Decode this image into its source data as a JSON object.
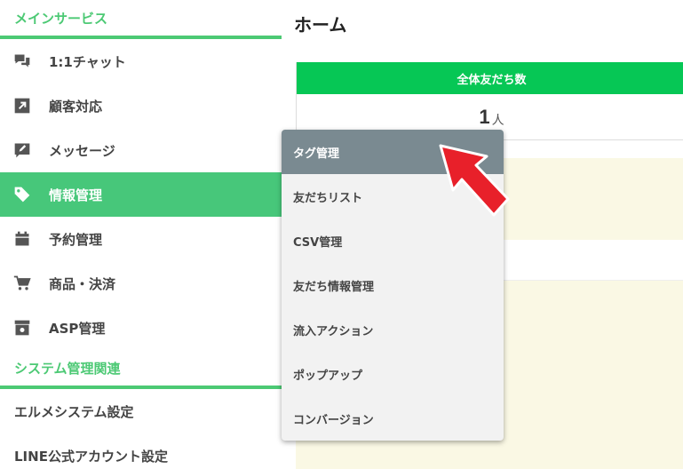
{
  "sidebar": {
    "main_section_title": "メインサービス",
    "items": [
      {
        "label": "1:1チャット",
        "icon": "chat-bubbles-icon"
      },
      {
        "label": "顧客対応",
        "icon": "arrow-up-right-icon"
      },
      {
        "label": "メッセージ",
        "icon": "edit-message-icon"
      },
      {
        "label": "情報管理",
        "icon": "tag-icon",
        "active": true
      },
      {
        "label": "予約管理",
        "icon": "calendar-icon"
      },
      {
        "label": "商品・決済",
        "icon": "cart-icon"
      },
      {
        "label": "ASP管理",
        "icon": "archive-icon"
      }
    ],
    "system_section_title": "システム管理関連",
    "system_items": [
      {
        "label": "エルメシステム設定"
      },
      {
        "label": "LINE公式アカウント設定"
      }
    ]
  },
  "main": {
    "page_title": "ホーム",
    "stat": {
      "header": "全体友だち数",
      "value": "1",
      "unit": "人"
    }
  },
  "dropdown": {
    "items": [
      {
        "label": "タグ管理",
        "active": true
      },
      {
        "label": "友だちリスト"
      },
      {
        "label": "CSV管理"
      },
      {
        "label": "友だち情報管理"
      },
      {
        "label": "流入アクション"
      },
      {
        "label": "ポップアップ"
      },
      {
        "label": "コンバージョン"
      }
    ]
  },
  "colors": {
    "accent_green": "#47c77a",
    "line_green": "#06c755",
    "dropdown_active": "#7a8a91",
    "annotation_arrow": "#e8202a"
  }
}
